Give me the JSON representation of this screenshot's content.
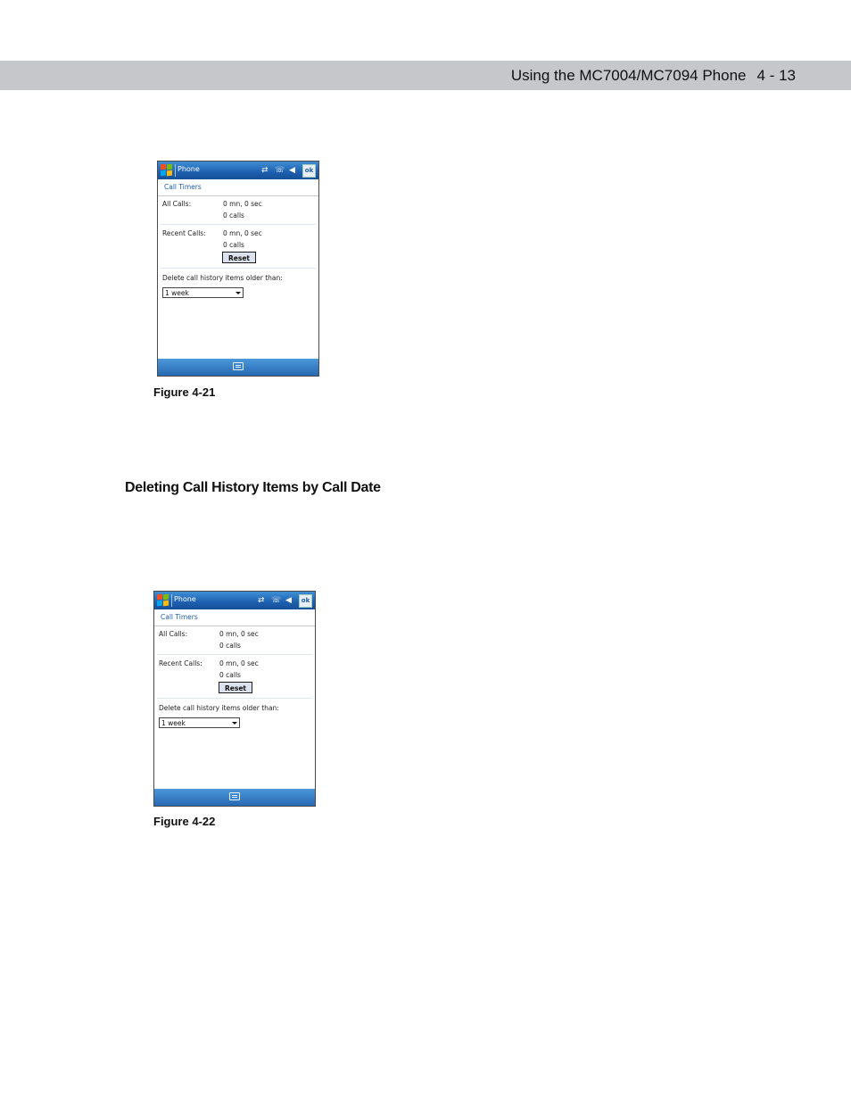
{
  "header": {
    "title": "Using the MC7004/MC7094 Phone",
    "page": "4 - 13"
  },
  "section_heading": "Deleting Call History Items by Call Date",
  "figures": [
    {
      "caption": "Figure 4-21",
      "screen": {
        "app_title": "Phone",
        "ok_label": "ok",
        "tab": "Call Timers",
        "all_calls_label": "All Calls:",
        "all_calls_time": "0 mn, 0 sec",
        "all_calls_count": "0 calls",
        "recent_calls_label": "Recent Calls:",
        "recent_calls_time": "0 mn, 0 sec",
        "recent_calls_count": "0 calls",
        "reset_label": "Reset",
        "delete_label": "Delete call history items older than:",
        "delete_selected": "1 week"
      }
    },
    {
      "caption": "Figure 4-22",
      "screen": {
        "app_title": "Phone",
        "ok_label": "ok",
        "tab": "Call Timers",
        "all_calls_label": "All Calls:",
        "all_calls_time": "0 mn, 0 sec",
        "all_calls_count": "0 calls",
        "recent_calls_label": "Recent Calls:",
        "recent_calls_time": "0 mn, 0 sec",
        "recent_calls_count": "0 calls",
        "reset_label": "Reset",
        "delete_label": "Delete call history items older than:",
        "delete_selected": "1 week"
      }
    }
  ],
  "icons": [
    "windows-start-icon",
    "connectivity-icon",
    "phone-signal-icon",
    "volume-icon",
    "keyboard-icon"
  ],
  "colors": {
    "header_band": "#c6c7cb",
    "titlebar_blue": "#1d5fae",
    "tab_text": "#1d5fae"
  }
}
